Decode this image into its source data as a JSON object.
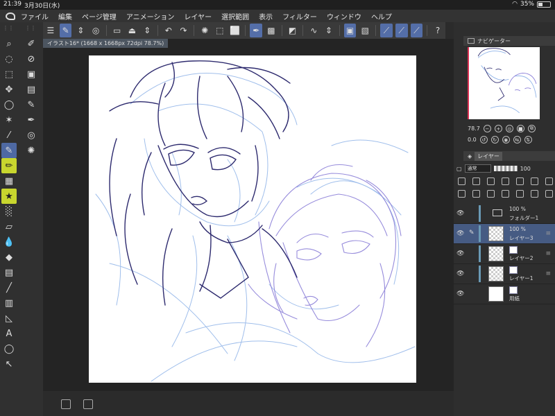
{
  "status": {
    "time": "21:39",
    "date": "3月30日(水)",
    "battery": "35%"
  },
  "menu": [
    "ファイル",
    "編集",
    "ページ管理",
    "アニメーション",
    "レイヤー",
    "選択範囲",
    "表示",
    "フィルター",
    "ウィンドウ",
    "ヘルプ"
  ],
  "canvas": {
    "tab_title": "イラスト16* (1668 x 1668px 72dpi 78.7%)"
  },
  "navigator": {
    "title": "ナビゲーター",
    "zoom": "78.7",
    "angle": "0.0"
  },
  "layers_panel": {
    "tab_label": "レイヤー",
    "blend_mode": "通常",
    "opacity": "100",
    "layers": [
      {
        "percent": "100 %",
        "name": "フォルダー1",
        "type": "folder",
        "selected": false
      },
      {
        "percent": "100 %",
        "name": "レイヤー3",
        "type": "raster",
        "selected": true
      },
      {
        "percent": "",
        "name": "レイヤー2",
        "type": "raster",
        "selected": false
      },
      {
        "percent": "",
        "name": "レイヤー1",
        "type": "raster",
        "selected": false
      },
      {
        "percent": "",
        "name": "用紙",
        "type": "paper",
        "selected": false
      }
    ]
  },
  "colors": {
    "accent": "#546ea8",
    "sketch_dark": "#2d2a6e",
    "sketch_light": "#8fb3e8",
    "sketch_violet": "#8b7fd8"
  }
}
